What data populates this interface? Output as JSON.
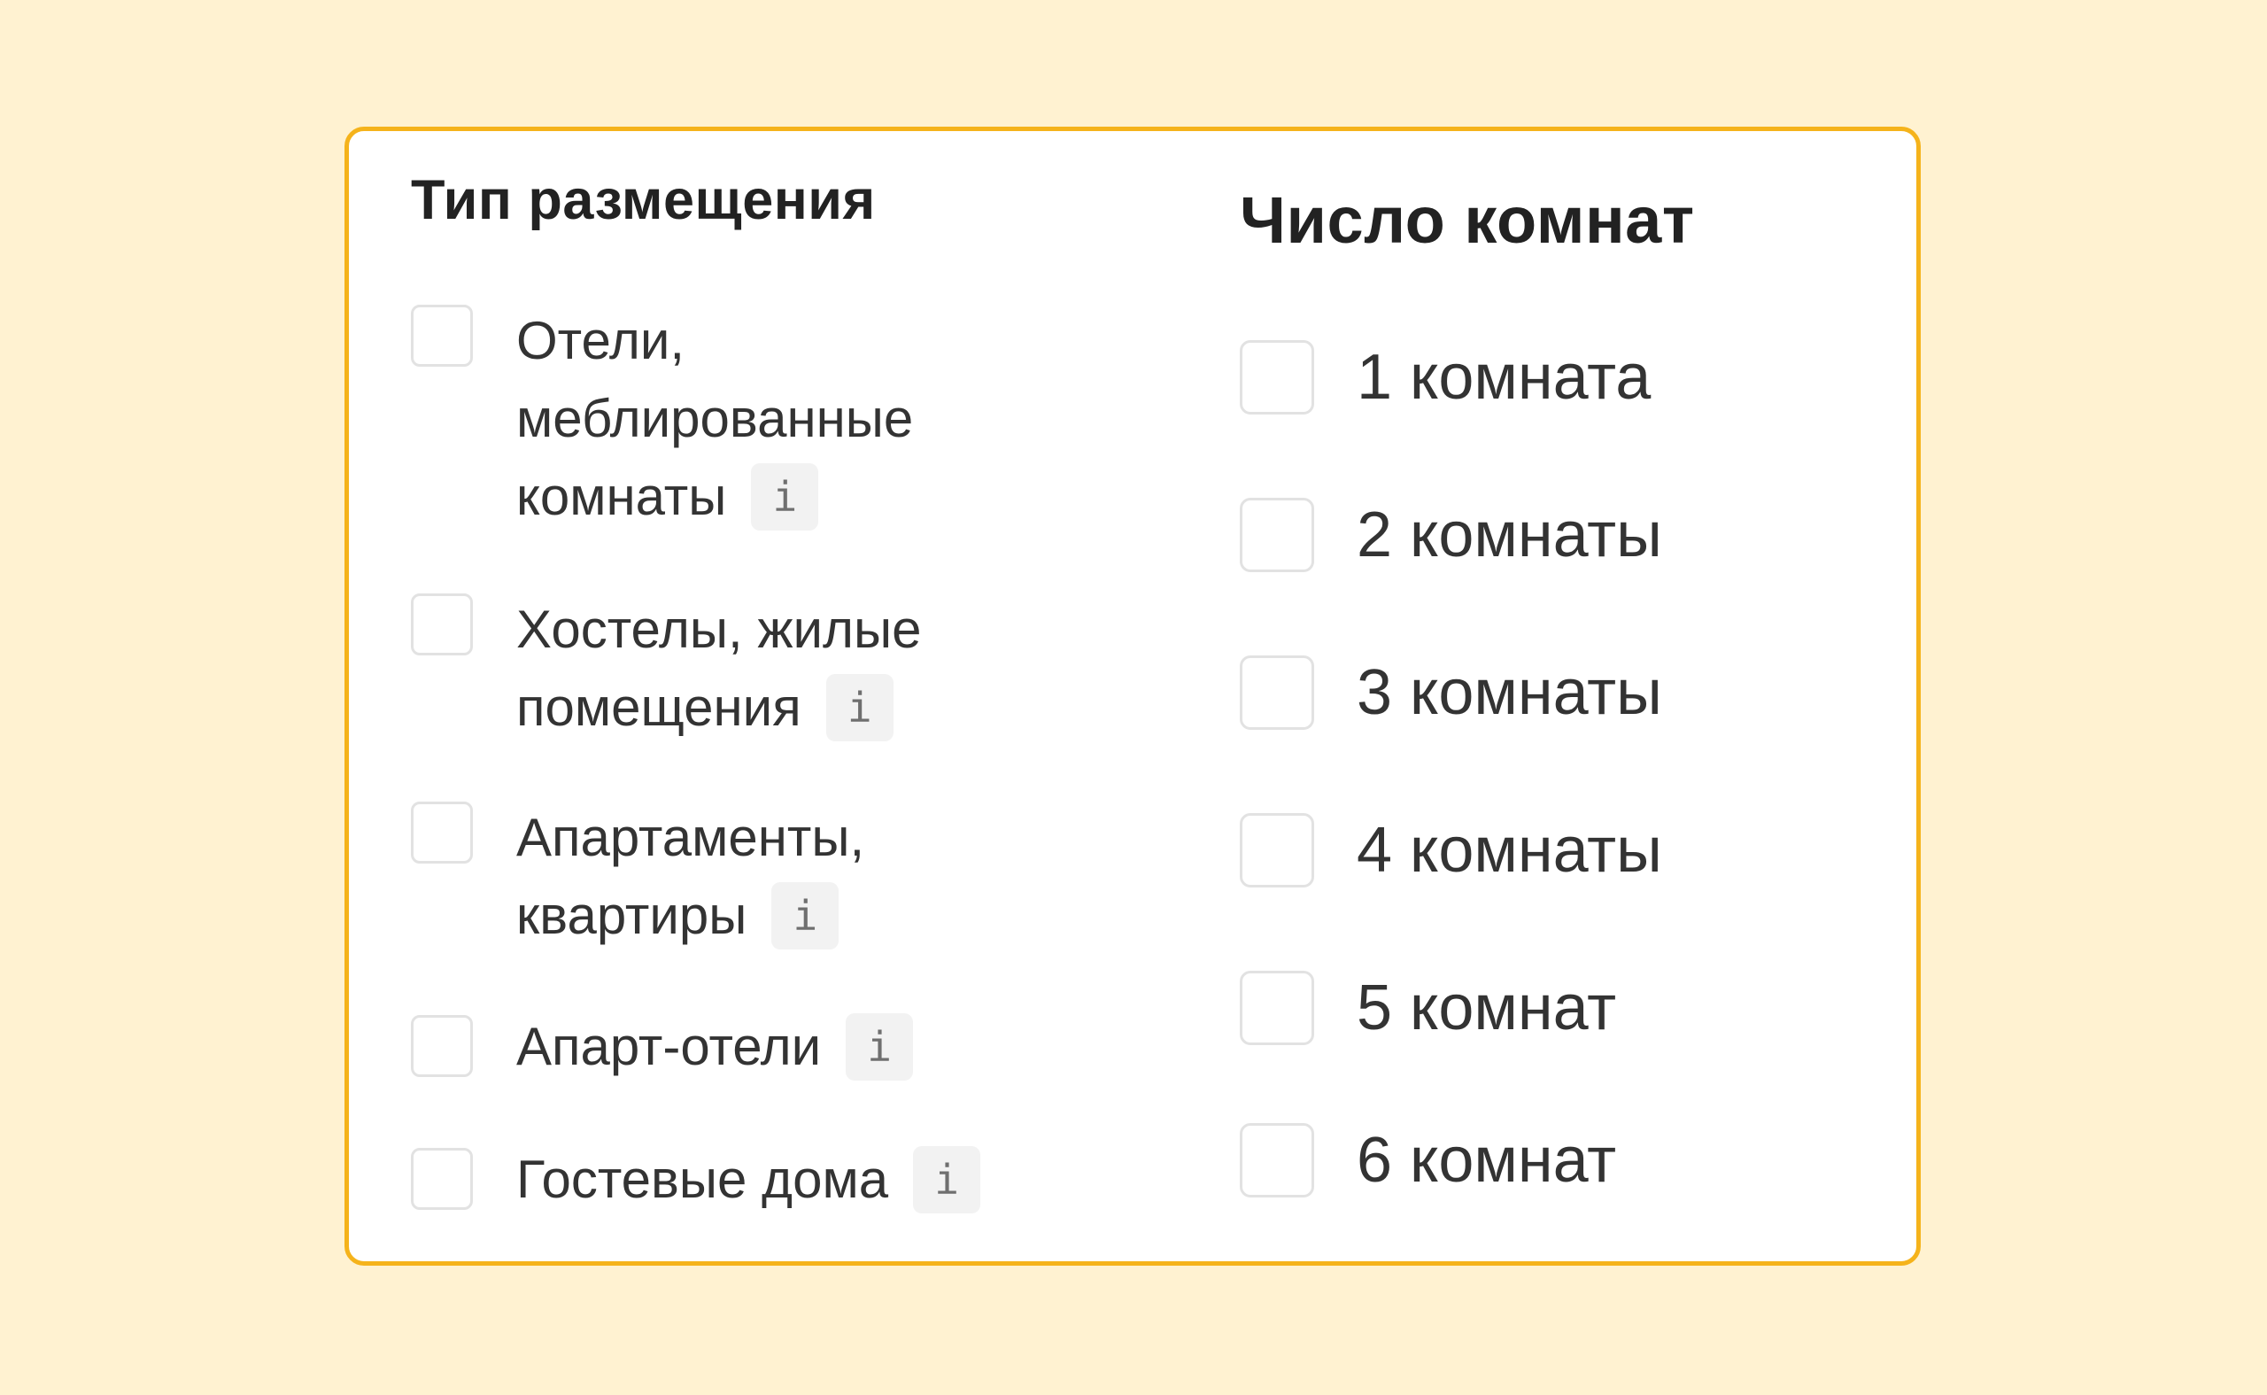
{
  "accommodation": {
    "title": "Тип размещения",
    "options": [
      {
        "lines": [
          "Отели,",
          "меблированные",
          "комнаты"
        ],
        "info_icon": "i",
        "checked": false
      },
      {
        "lines": [
          "Хостелы, жилые",
          "помещения"
        ],
        "info_icon": "i",
        "checked": false
      },
      {
        "lines": [
          "Апартаменты,",
          "квартиры"
        ],
        "info_icon": "i",
        "checked": false
      },
      {
        "lines": [
          "Апарт-отели"
        ],
        "info_icon": "i",
        "checked": false
      },
      {
        "lines": [
          "Гостевые дома"
        ],
        "info_icon": "i",
        "checked": false
      }
    ]
  },
  "rooms": {
    "title": "Число комнат",
    "options": [
      {
        "label": "1 комната",
        "checked": false
      },
      {
        "label": "2 комнаты",
        "checked": false
      },
      {
        "label": "3 комнаты",
        "checked": false
      },
      {
        "label": "4 комнаты",
        "checked": false
      },
      {
        "label": "5 комнат",
        "checked": false
      },
      {
        "label": "6 комнат",
        "checked": false
      }
    ]
  },
  "colors": {
    "page_background": "#FFF2D1",
    "card_border": "#F5B31B",
    "checkbox_border": "#E2E2E2",
    "info_badge_background": "#F2F2F2"
  }
}
